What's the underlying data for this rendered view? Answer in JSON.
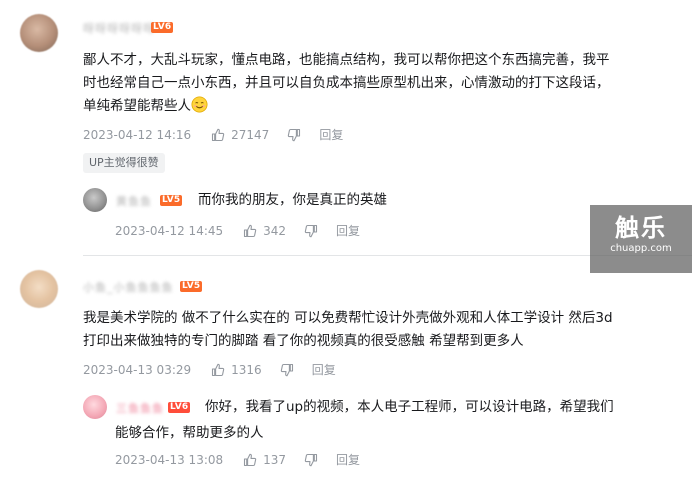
{
  "comments": [
    {
      "username": "呀呀呀呀呀呀",
      "level": "LV6",
      "content_lines": [
        "鄙人不才，大乱斗玩家，懂点电路，也能搞点结构，我可以帮你把这个东西搞完善，我平",
        "时也经常自己一点小东西，并且可以自负成本搞些原型机出来，心情激动的打下这段话，",
        "单纯希望能帮些人"
      ],
      "date": "2023-04-12 14:16",
      "likes": "27147",
      "reply_label": "回复",
      "up_tag": "UP主觉得很赞",
      "reply": {
        "username": "黄鱼鱼",
        "level": "LV5",
        "content_lines": [
          "而你我的朋友，你是真正的英雄"
        ],
        "date": "2023-04-12 14:45",
        "likes": "342",
        "reply_label": "回复"
      }
    },
    {
      "username": "小鱼_小鱼鱼鱼鱼",
      "level": "LV5",
      "content_lines": [
        "我是美术学院的 做不了什么实在的 可以免费帮忙设计外壳做外观和人体工学设计 然后3d",
        "打印出来做独特的专门的脚踏 看了你的视频真的很受感触 希望帮到更多人"
      ],
      "date": "2023-04-13 03:29",
      "likes": "1316",
      "reply_label": "回复",
      "reply": {
        "username": "三鱼鱼鱼",
        "level": "LV6",
        "content_lines": [
          "你好，我看了up的视频，本人电子工程师，可以设计电路，希望我们",
          "能够合作，帮助更多的人"
        ],
        "date": "2023-04-13 13:08",
        "likes": "137",
        "reply_label": "回复"
      }
    }
  ],
  "watermark": {
    "main": "触乐",
    "sub": "chuapp.com"
  },
  "icons": {
    "like": "thumbs-up-icon",
    "dislike": "thumbs-down-icon",
    "emoji": "smile-emoji-icon"
  },
  "colors": {
    "text": "#18191c",
    "meta": "#9499a0",
    "level_orange": "#fb6b2a",
    "level_red": "#ff4d3a"
  }
}
